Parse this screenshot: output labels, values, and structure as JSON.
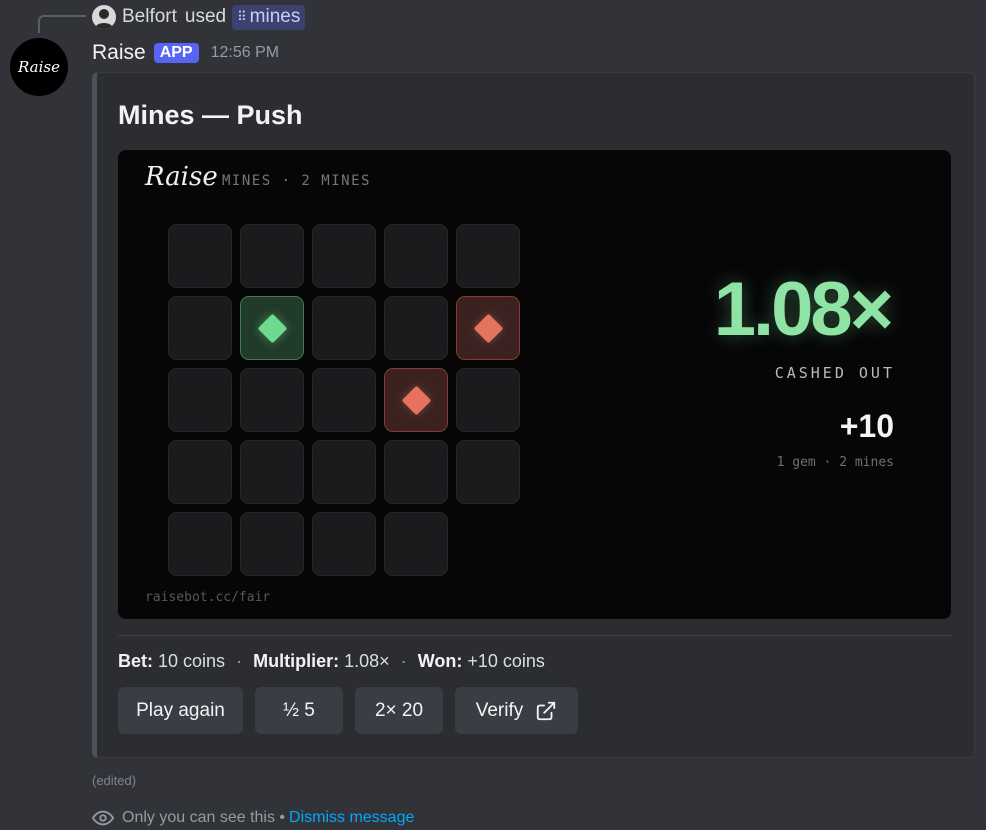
{
  "reply": {
    "user_name": "Belfort",
    "verb": "used",
    "command": "mines"
  },
  "message": {
    "bot_name": "Raise",
    "bot_avatar_text": "Raise",
    "badge": "APP",
    "timestamp": "12:56 PM"
  },
  "embed": {
    "title": "Mines — Push",
    "image": {
      "logo": "Raise",
      "subtitle": "MINES · 2 MINES",
      "grid": [
        [
          "blank",
          "blank",
          "blank",
          "blank",
          "blank"
        ],
        [
          "blank",
          "gem",
          "blank",
          "blank",
          "mine"
        ],
        [
          "blank",
          "blank",
          "blank",
          "mine",
          "blank"
        ],
        [
          "blank",
          "blank",
          "blank",
          "blank",
          "blank"
        ],
        [
          "blank",
          "blank",
          "blank",
          "blank",
          "empty"
        ]
      ],
      "footer": "raisebot.cc/fair",
      "multiplier": "1.08×",
      "status": "CASHED OUT",
      "winnings": "+10",
      "gem_info": "1 gem · 2 mines"
    },
    "summary": {
      "bet_label": "Bet:",
      "bet_value": "10 coins",
      "multiplier_label": "Multiplier:",
      "multiplier_value": "1.08×",
      "won_label": "Won:",
      "won_value": "+10 coins",
      "separator": "·"
    },
    "buttons": {
      "play_again": "Play again",
      "half": "½ 5",
      "double": "2× 20",
      "verify": "Verify"
    }
  },
  "footer": {
    "edited": "(edited)",
    "ephemeral_text": "Only you can see this •",
    "dismiss_link": "Dismiss message"
  },
  "colors": {
    "accent": "#5865f2",
    "gem": "#6fd98e",
    "mine": "#e4725f",
    "multiplier": "#8fe3a5",
    "link": "#00a8fc"
  }
}
